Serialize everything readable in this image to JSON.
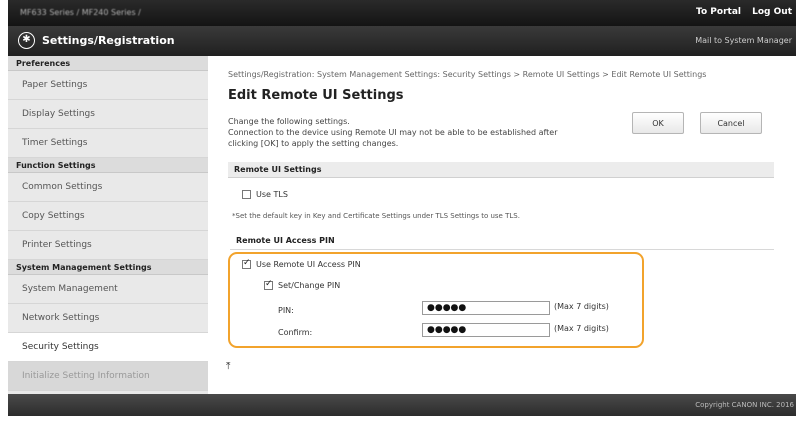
{
  "header": {
    "model": "MF633 Series / MF240 Series /",
    "to_portal": "To Portal",
    "logout": "Log Out",
    "app_title": "Settings/Registration",
    "mail_to": "Mail to System Manager"
  },
  "sidebar": {
    "sections": [
      {
        "title": "Preferences",
        "items": [
          "Paper Settings",
          "Display Settings",
          "Timer Settings"
        ]
      },
      {
        "title": "Function Settings",
        "items": [
          "Common Settings",
          "Copy Settings",
          "Printer Settings"
        ]
      },
      {
        "title": "System Management Settings",
        "items": [
          "System Management",
          "Network Settings",
          "Security Settings",
          "Initialize Setting Information"
        ]
      }
    ]
  },
  "main": {
    "breadcrumb": "Settings/Registration: System Management Settings: Security Settings > Remote UI Settings > Edit Remote UI Settings",
    "title": "Edit Remote UI Settings",
    "desc_line1": "Change the following settings.",
    "desc_line2": "Connection to the device using Remote UI may not be able to be established after",
    "desc_line3": "clicking [OK] to apply the setting changes.",
    "ok_label": "OK",
    "cancel_label": "Cancel",
    "remote_ui_settings": {
      "title": "Remote UI Settings",
      "use_tls_label": "Use TLS",
      "use_tls_checked": false,
      "note": "*Set the default key in Key and Certificate Settings under TLS Settings to use TLS."
    },
    "access_pin": {
      "title": "Remote UI Access PIN",
      "use_pin_label": "Use Remote UI Access PIN",
      "use_pin_checked": true,
      "set_change_label": "Set/Change PIN",
      "set_change_checked": true,
      "pin_label": "PIN:",
      "pin_value": "●●●●●",
      "pin_max": "(Max 7 digits)",
      "confirm_label": "Confirm:",
      "confirm_value": "●●●●●",
      "confirm_max": "(Max 7 digits)"
    }
  },
  "footer": {
    "copyright": "Copyright CANON INC. 2016"
  },
  "colors": {
    "highlight": "#f2a32c",
    "topbar": "#1c1c1c",
    "sidebar": "#e9e9e9"
  }
}
